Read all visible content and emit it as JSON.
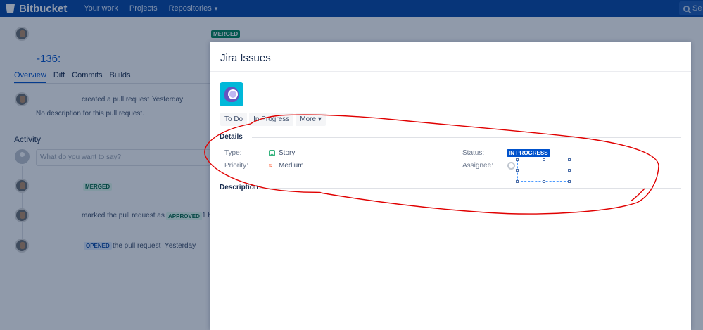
{
  "topbar": {
    "brand": "Bitbucket",
    "nav": [
      "Your work",
      "Projects",
      "Repositories"
    ],
    "search_placeholder": "Se"
  },
  "page": {
    "pr_id": "-136:",
    "merged_badge": "MERGED",
    "tabs": [
      "Overview",
      "Diff",
      "Commits",
      "Builds"
    ],
    "created_text": "created a pull request",
    "created_time": "Yesterday",
    "no_description": "No description for this pull request.",
    "activity_heading": "Activity",
    "comment_placeholder": "What do you want to say?",
    "events": [
      {
        "badge": "MERGED"
      },
      {
        "text": "marked the pull request as",
        "badge": "APPROVED",
        "suffix": "1 h"
      },
      {
        "badge": "OPENED",
        "text": "the pull request",
        "time": "Yesterday"
      }
    ]
  },
  "modal": {
    "title": "Jira Issues",
    "buttons": [
      "To Do",
      "In Progress",
      "More"
    ],
    "details_heading": "Details",
    "type_label": "Type:",
    "type_value": "Story",
    "priority_label": "Priority:",
    "priority_value": "Medium",
    "status_label": "Status:",
    "status_value": "IN PROGRESS",
    "assignee_label": "Assignee:",
    "description_heading": "Description"
  },
  "colors": {
    "nav_bg": "#0747a6",
    "link": "#0052cc",
    "annotation": "#e00000"
  }
}
